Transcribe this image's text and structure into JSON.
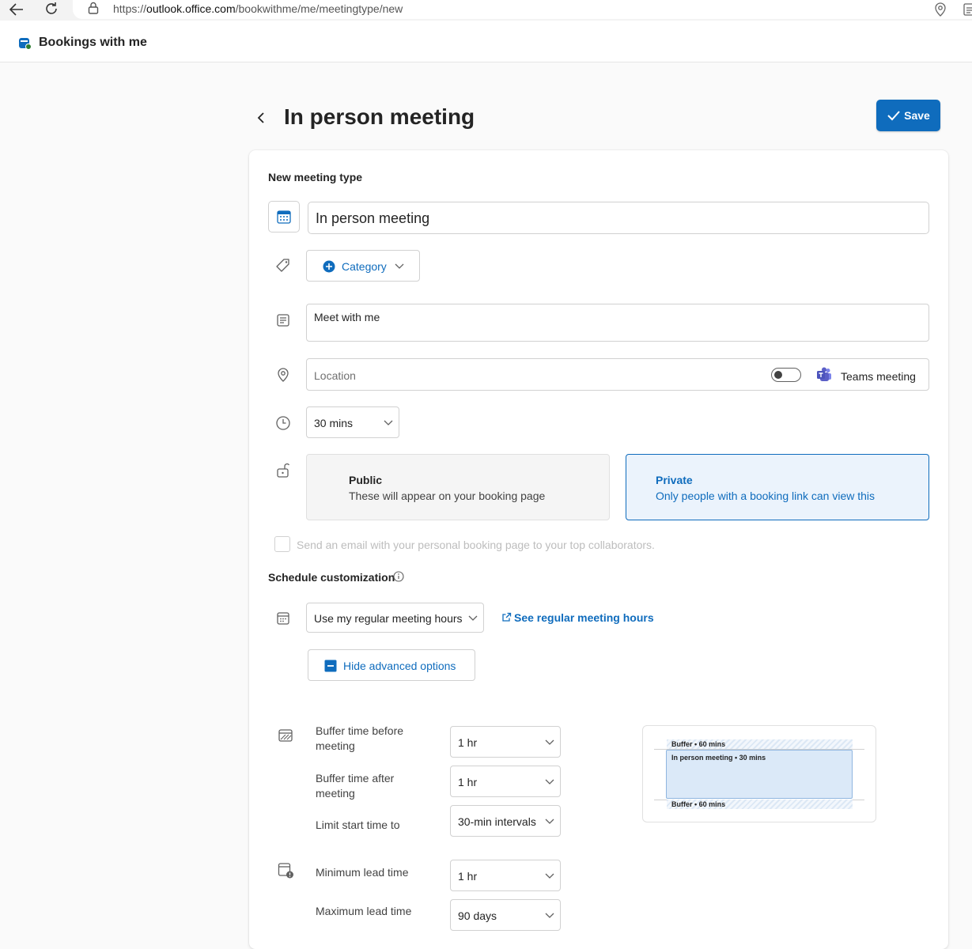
{
  "browser": {
    "url_prefix": "https://",
    "url_host": "outlook.office.com",
    "url_path": "/bookwithme/me/meetingtype/new"
  },
  "app": {
    "title": "Bookings with me"
  },
  "page": {
    "title": "In person meeting",
    "save_label": "Save"
  },
  "form": {
    "section_title": "New meeting type",
    "meeting_name": "In person meeting",
    "category_label": "Category",
    "description": "Meet with me",
    "location_placeholder": "Location",
    "teams_label": "Teams meeting",
    "teams_toggle_on": false,
    "duration": "30 mins",
    "visibility": {
      "public_title": "Public",
      "public_desc": "These will appear on your booking page",
      "private_title": "Private",
      "private_desc": "Only people with a booking link can view this",
      "selected": "private"
    },
    "email_checkbox_label": "Send an email with your personal booking page to your top collaborators."
  },
  "schedule": {
    "title": "Schedule customization",
    "hours_select": "Use my regular meeting hours",
    "see_hours_link": "See regular meeting hours",
    "hide_advanced_label": "Hide advanced options",
    "buffer_before_label": "Buffer time before meeting",
    "buffer_before_value": "1 hr",
    "buffer_after_label": "Buffer time after meeting",
    "buffer_after_value": "1 hr",
    "limit_start_label": "Limit start time to",
    "limit_start_value": "30-min intervals",
    "min_lead_label": "Minimum lead time",
    "min_lead_value": "1 hr",
    "max_lead_label": "Maximum lead time",
    "max_lead_value": "90 days"
  },
  "preview": {
    "buffer_top": "Buffer • 60 mins",
    "meeting": "In person meeting • 30 mins",
    "buffer_bottom": "Buffer • 60 mins"
  },
  "colors": {
    "accent": "#0f6cbd",
    "private_bg": "#ebf3fc",
    "teams_purple": "#5b5fc7"
  }
}
